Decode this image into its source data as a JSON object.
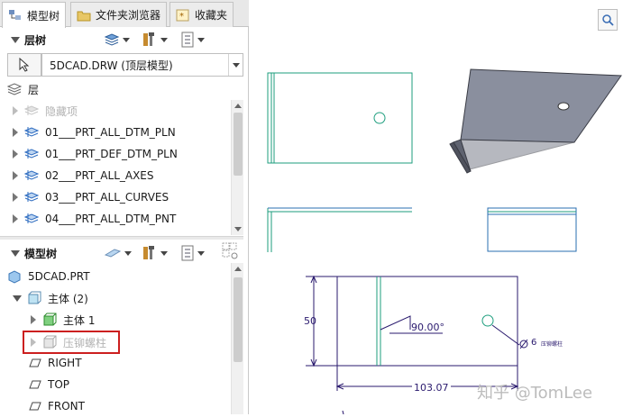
{
  "tabs": [
    {
      "label": "模型树",
      "icon": "model-tree-icon"
    },
    {
      "label": "文件夹浏览器",
      "icon": "folder-icon"
    },
    {
      "label": "收藏夹",
      "icon": "favorites-icon"
    }
  ],
  "layer_tree": {
    "title": "层树",
    "model_select": "5DCAD.DRW (顶层模型)",
    "root": "层",
    "items": [
      {
        "label": "隐藏项",
        "disabled": true
      },
      {
        "label": "01___PRT_ALL_DTM_PLN"
      },
      {
        "label": "01___PRT_DEF_DTM_PLN"
      },
      {
        "label": "02___PRT_ALL_AXES"
      },
      {
        "label": "03___PRT_ALL_CURVES"
      },
      {
        "label": "04___PRT_ALL_DTM_PNT"
      }
    ]
  },
  "model_tree": {
    "title": "模型树",
    "items": [
      {
        "label": "5DCAD.PRT",
        "icon": "part-icon"
      },
      {
        "label": "主体 (2)",
        "icon": "body-group-icon"
      },
      {
        "label": "主体 1",
        "icon": "body-icon"
      },
      {
        "label": "压铆螺柱",
        "icon": "body-icon",
        "disabled": true,
        "highlighted": true
      },
      {
        "label": "RIGHT",
        "icon": "datum-plane-icon"
      },
      {
        "label": "TOP",
        "icon": "datum-plane-icon"
      },
      {
        "label": "FRONT",
        "icon": "datum-plane-icon"
      }
    ]
  },
  "drawing": {
    "dim_height": "50",
    "dim_angle": "90.00°",
    "dim_width": "103.07",
    "dim_hole": "6",
    "hole_note": "压铆螺柱",
    "watermark": "知乎 @TomLee"
  },
  "colors": {
    "view_line": "#1e9e7e",
    "view_line_blue": "#2a6fb0",
    "dimension": "#2a1a6e",
    "highlight_box": "#cc1f1f",
    "shaded_part": "#8a8f9e"
  }
}
